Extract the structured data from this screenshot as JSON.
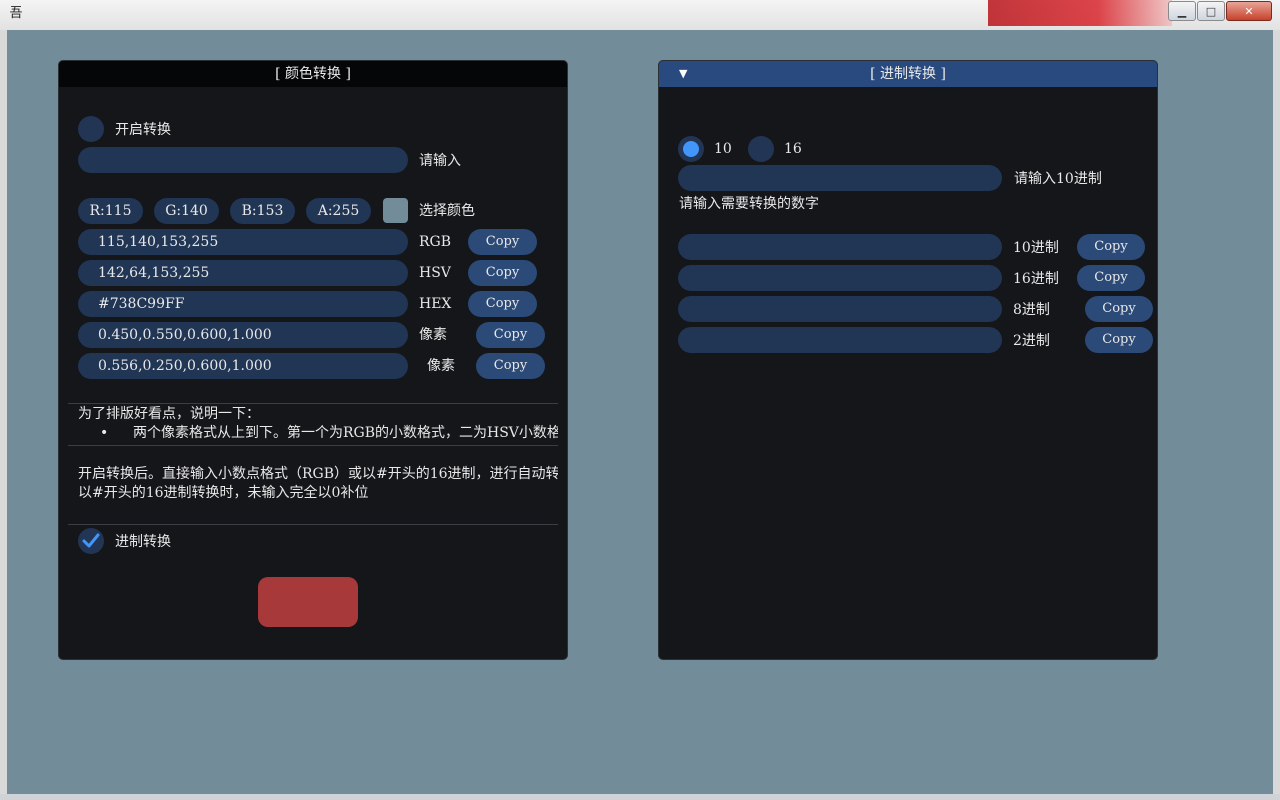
{
  "window": {
    "app_icon_glyph": "吾",
    "minimize_glyph": "▁",
    "maximize_glyph": "□",
    "close_glyph": "✕"
  },
  "color_panel": {
    "title": "[ 颜色转换 ]",
    "enable_label": "开启转换",
    "input_hint": "请输入",
    "channels": {
      "r": "R:115",
      "g": "G:140",
      "b": "B:153",
      "a": "A:255"
    },
    "swatch_color": "#738C99",
    "pick_color_label": "选择颜色",
    "rows": [
      {
        "value": "115,140,153,255",
        "label": "RGB",
        "button": "Copy"
      },
      {
        "value": "142,64,153,255",
        "label": "HSV",
        "button": "Copy"
      },
      {
        "value": "#738C99FF",
        "label": "HEX",
        "button": "Copy"
      },
      {
        "value": "0.450,0.550,0.600,1.000",
        "label": "像素",
        "button": "Copy"
      },
      {
        "value": "0.556,0.250,0.600,1.000",
        "label": "像素",
        "button": "Copy"
      }
    ],
    "note_title": "为了排版好看点，说明一下：",
    "note_bullet_glyph": "•",
    "note_bullet": "两个像素格式从上到下。第一个为RGB的小数格式，二为HSV小数格式",
    "desc_line1": "开启转换后。直接输入小数点格式（RGB）或以#开头的16进制，进行自动转换",
    "desc_line2": "以#开头的16进制转换时，未输入完全以0补位",
    "base_convert_label": "进制转换",
    "base_convert_checked": true
  },
  "base_panel": {
    "title": "[ 进制转换 ]",
    "collapse_glyph": "▼",
    "radio_10": "10",
    "radio_16": "16",
    "selected_radio": "10",
    "input_hint": "请输入10进制",
    "prompt": "请输入需要转换的数字",
    "rows": [
      {
        "value": "",
        "label": "10进制",
        "button": "Copy"
      },
      {
        "value": "",
        "label": "16进制",
        "button": "Copy"
      },
      {
        "value": "",
        "label": "8进制",
        "button": "Copy"
      },
      {
        "value": "",
        "label": "2进制",
        "button": "Copy"
      }
    ]
  },
  "colors": {
    "background": "#738C99",
    "panel": "#141619",
    "field": "#213554",
    "button": "#2B4A78",
    "accent": "#4296FA",
    "header_active": "#284A7E",
    "red_button": "#A8393B"
  }
}
